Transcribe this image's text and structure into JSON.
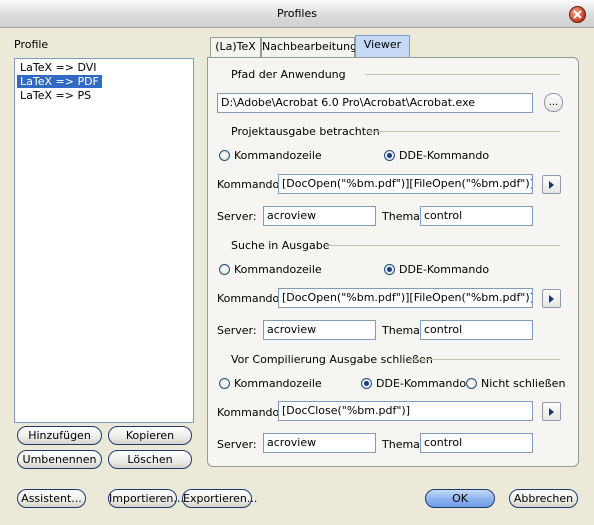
{
  "window": {
    "title": "Profiles"
  },
  "profiles": {
    "label": "Profile",
    "items": [
      "LaTeX => DVI",
      "LaTeX => PDF",
      "LaTeX => PS"
    ],
    "selected_index": 1
  },
  "profile_buttons": {
    "add": "Hinzufügen",
    "copy": "Kopieren",
    "rename": "Umbenennen",
    "delete": "Löschen"
  },
  "tabs": [
    {
      "label": "(La)TeX",
      "active": false
    },
    {
      "label": "Nachbearbeitung",
      "active": false
    },
    {
      "label": "Viewer",
      "active": true
    }
  ],
  "viewer": {
    "app_path": {
      "label": "Pfad der Anwendung",
      "value": "D:\\Adobe\\Acrobat 6.0 Pro\\Acrobat\\Acrobat.exe",
      "browse": "..."
    },
    "sections": [
      {
        "title": "Projektausgabe betrachten",
        "options": [
          {
            "label": "Kommandozeile",
            "checked": false
          },
          {
            "label": "DDE-Kommando",
            "checked": true
          }
        ],
        "command_label": "Kommando:",
        "command_value": "[DocOpen(\"%bm.pdf\")][FileOpen(\"%bm.pdf\")]",
        "server_label": "Server:",
        "server_value": "acroview",
        "topic_label": "Thema:",
        "topic_value": "control"
      },
      {
        "title": "Suche in Ausgabe",
        "options": [
          {
            "label": "Kommandozeile",
            "checked": false
          },
          {
            "label": "DDE-Kommando",
            "checked": true
          }
        ],
        "command_label": "Kommando:",
        "command_value": "[DocOpen(\"%bm.pdf\")][FileOpen(\"%bm.pdf\")]",
        "server_label": "Server:",
        "server_value": "acroview",
        "topic_label": "Thema:",
        "topic_value": "control"
      },
      {
        "title": "Vor Compilierung Ausgabe schließen",
        "options": [
          {
            "label": "Kommandozeile",
            "checked": false
          },
          {
            "label": "DDE-Kommando",
            "checked": true
          },
          {
            "label": "Nicht schließen",
            "checked": false
          }
        ],
        "command_label": "Kommando:",
        "command_value": "[DocClose(\"%bm.pdf\")]",
        "server_label": "Server:",
        "server_value": "acroview",
        "topic_label": "Thema:",
        "topic_value": "control"
      }
    ],
    "arrow_icon": "triangle-right"
  },
  "footer": {
    "wizard": "Assistent...",
    "import": "Importieren...",
    "export": "Exportieren...",
    "ok": "OK",
    "cancel": "Abbrechen"
  },
  "colors": {
    "selection": "#316ac5",
    "dialog_bg": "#ece9d8",
    "active_tab": "#c6d9f5"
  }
}
